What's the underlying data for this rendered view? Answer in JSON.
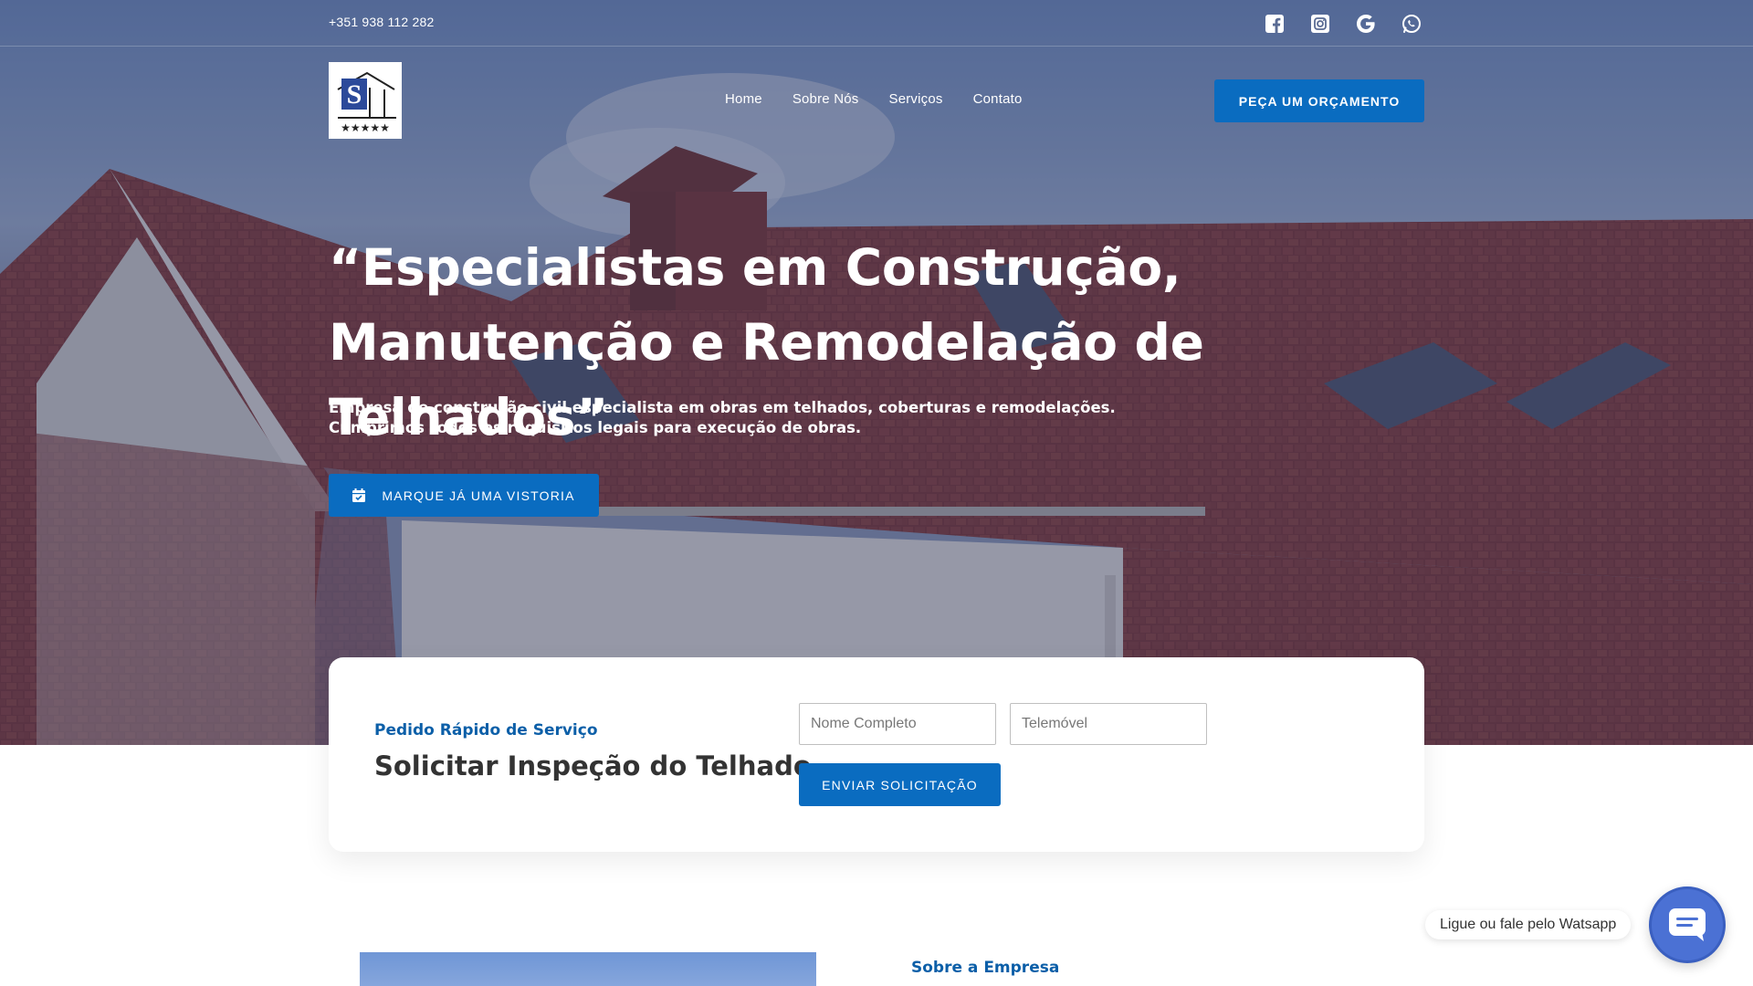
{
  "topbar": {
    "phone": "+351 938 112 282",
    "social_icons": [
      "facebook-icon",
      "instagram-icon",
      "google-icon",
      "whatsapp-icon"
    ]
  },
  "header": {
    "logo": "logo",
    "nav": [
      {
        "label": "Home"
      },
      {
        "label": "Sobre Nós"
      },
      {
        "label": "Serviços"
      },
      {
        "label": "Contato"
      }
    ],
    "quote_button": "PEÇA UM ORÇAMENTO"
  },
  "hero": {
    "title_line1": "“Especialistas em Construção,",
    "title_line2": "Manutenção e Remodelação de Telhados”",
    "subtitle_line1": "Empresa de construção civil especialista em obras em telhados, coberturas e remodelações.",
    "subtitle_line2": "Cumprimos todos os requisitos legais para execução de obras.",
    "cta_label": "MARQUE JÁ UMA VISTORIA",
    "cta_icon": "calendar-icon"
  },
  "quick_request": {
    "kicker": "Pedido Rápido de Serviço",
    "title": "Solicitar Inspeção do Telhado",
    "name_placeholder": "Nome Completo",
    "phone_placeholder": "Telemóvel",
    "submit_label": "ENVIAR SOLICITAÇÃO"
  },
  "about": {
    "kicker": "Sobre a Empresa"
  },
  "chat": {
    "label": "Ligue ou fale pelo Watsapp",
    "icon": "chat-icon"
  },
  "colors": {
    "primary": "#0a6cc0",
    "kicker": "#0c5fa8",
    "chat": "#4b71d4"
  }
}
